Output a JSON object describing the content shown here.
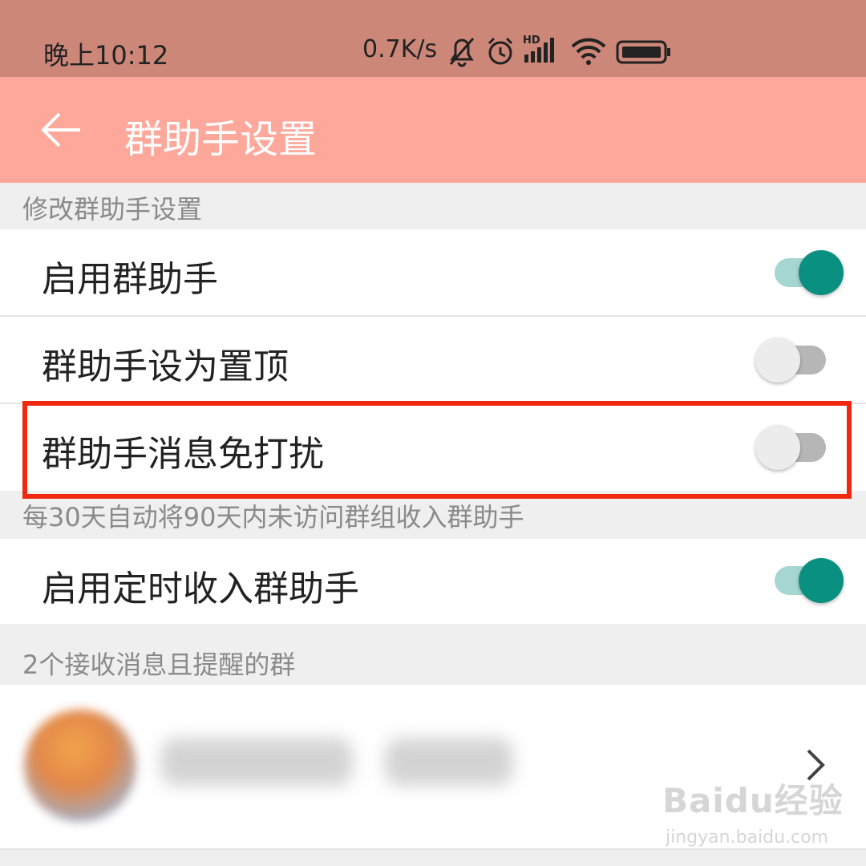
{
  "status_bar": {
    "time": "晚上10:12",
    "network_speed": "0.7K/s",
    "signal_tag": "HD",
    "icons": [
      "bell-off-icon",
      "alarm-icon",
      "cellular-signal-icon",
      "wifi-icon",
      "battery-icon"
    ]
  },
  "app_bar": {
    "back_icon": "arrow-left-icon",
    "title": "群助手设置",
    "background_color": "#fea89b"
  },
  "section1": {
    "header": "修改群助手设置",
    "items": [
      {
        "label": "启用群助手",
        "enabled": true
      },
      {
        "label": "群助手设为置顶",
        "enabled": false
      },
      {
        "label": "群助手消息免打扰",
        "enabled": false,
        "highlighted": true
      }
    ]
  },
  "section2": {
    "header": "每30天自动将90天内未访问群组收入群助手",
    "items": [
      {
        "label": "启用定时收入群助手",
        "enabled": true
      }
    ]
  },
  "section3": {
    "header": "2个接收消息且提醒的群",
    "chevron_icon": "chevron-right-icon"
  },
  "colors": {
    "toggle_on": "#0a9080",
    "highlight_border": "#f02810"
  },
  "watermark": {
    "brand": "Baidu经验",
    "url": "jingyan.baidu.com"
  }
}
